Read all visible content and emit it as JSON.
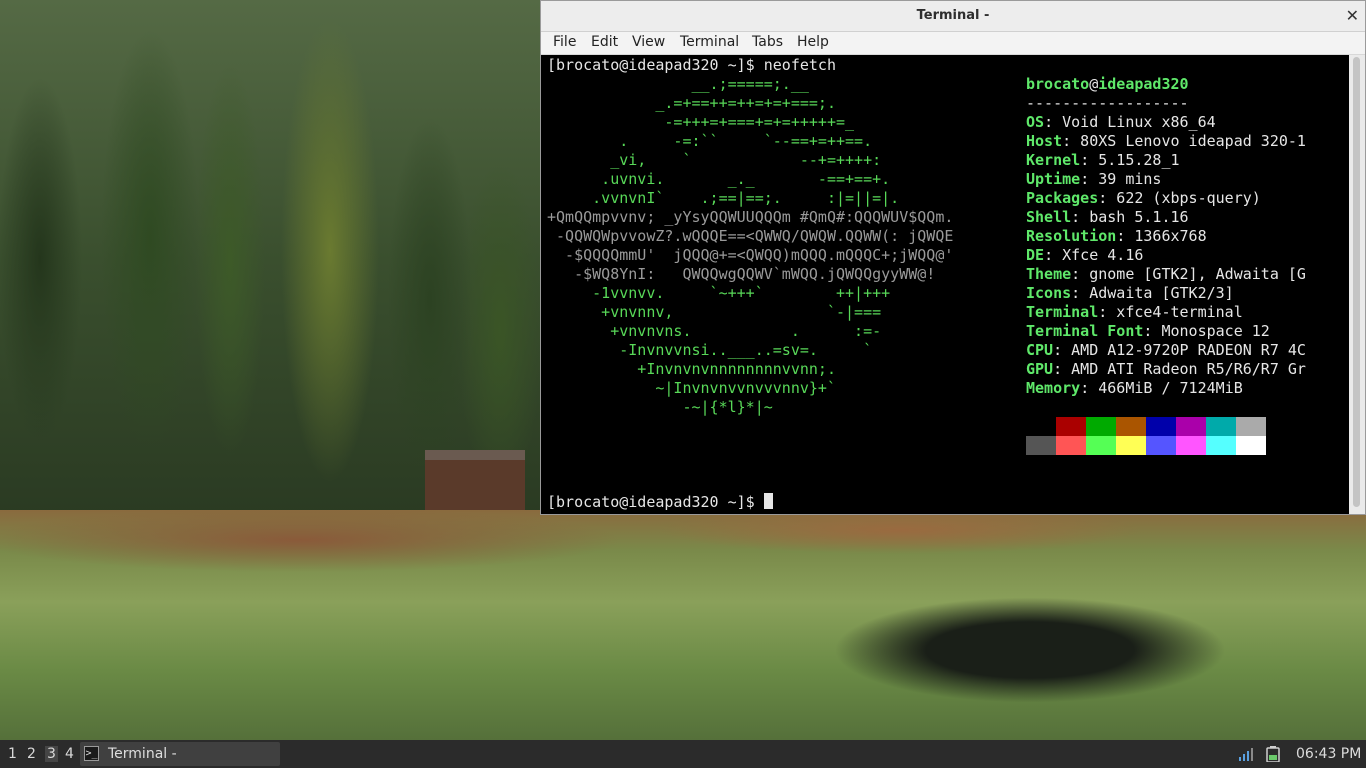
{
  "window": {
    "title": "Terminal -",
    "menu": [
      "File",
      "Edit",
      "View",
      "Terminal",
      "Tabs",
      "Help"
    ]
  },
  "terminal": {
    "prompt_line": "[brocato@ideapad320 ~]$ neofetch",
    "prompt_end": "[brocato@ideapad320 ~]$ ",
    "user_host_user": "brocato",
    "user_host_at": "@",
    "user_host_host": "ideapad320",
    "separator": "------------------",
    "info": [
      {
        "key": "OS",
        "value": ": Void Linux x86_64"
      },
      {
        "key": "Host",
        "value": ": 80XS Lenovo ideapad 320-1"
      },
      {
        "key": "Kernel",
        "value": ": 5.15.28_1"
      },
      {
        "key": "Uptime",
        "value": ": 39 mins"
      },
      {
        "key": "Packages",
        "value": ": 622 (xbps-query)"
      },
      {
        "key": "Shell",
        "value": ": bash 5.1.16"
      },
      {
        "key": "Resolution",
        "value": ": 1366x768"
      },
      {
        "key": "DE",
        "value": ": Xfce 4.16"
      },
      {
        "key": "Theme",
        "value": ": gnome [GTK2], Adwaita [G"
      },
      {
        "key": "Icons",
        "value": ": Adwaita [GTK2/3]"
      },
      {
        "key": "Terminal",
        "value": ": xfce4-terminal"
      },
      {
        "key": "Terminal Font",
        "value": ": Monospace 12"
      },
      {
        "key": "CPU",
        "value": ": AMD A12-9720P RADEON R7 4C"
      },
      {
        "key": "GPU",
        "value": ": AMD ATI Radeon R5/R6/R7 Gr"
      },
      {
        "key": "Memory",
        "value": ": 466MiB / 7124MiB"
      }
    ],
    "logo": [
      "                __.;=====;.__",
      "            _.=+==++=++=+=+===;.",
      "             -=+++=+===+=+=+++++=_",
      "        .     -=:``     `--==+=++==.",
      "       _vi,    `            --+=++++:",
      "      .uvnvi.       _._       -==+==+.",
      "     .vvnvnI`    .;==|==;.     :|=||=|.",
      "+QmQQmpvvnv; _yYsyQQWUUQQQm #QmQ#:QQQWUV$QQm.",
      " -QQWQWpvvowZ?.wQQQE==<QWWQ/QWQW.QQWW(: jQWQE",
      "  -$QQQQmmU'  jQQQ@+=<QWQQ)mQQQ.mQQQC+;jWQQ@'",
      "   -$WQ8YnI:   QWQQwgQQWV`mWQQ.jQWQQgyyWW@!",
      "     -1vvnvv.     `~+++`        ++|+++",
      "      +vnvnnv,                 `-|===",
      "       +vnvnvns.           .      :=-",
      "        -Invnvvnsi..___..=sv=.     `",
      "          +Invnvnvnnnnnnnnvvnn;.",
      "            ~|Invnvnvvnvvvnnv}+`",
      "               -~|{*l}*|~"
    ],
    "palette_top": [
      "#000000",
      "#aa0000",
      "#00aa00",
      "#aa5500",
      "#0000aa",
      "#aa00aa",
      "#00aaaa",
      "#aaaaaa"
    ],
    "palette_bottom": [
      "#555555",
      "#ff5555",
      "#55ff55",
      "#ffff55",
      "#5555ff",
      "#ff55ff",
      "#55ffff",
      "#ffffff"
    ]
  },
  "taskbar": {
    "workspaces": [
      "1",
      "2",
      "3",
      "4"
    ],
    "active_workspace": "3",
    "task_label": "Terminal -",
    "task_icon": "terminal-icon",
    "tray_icons": [
      "network-signal-icon",
      "battery-icon"
    ],
    "clock": "06:43 PM"
  }
}
